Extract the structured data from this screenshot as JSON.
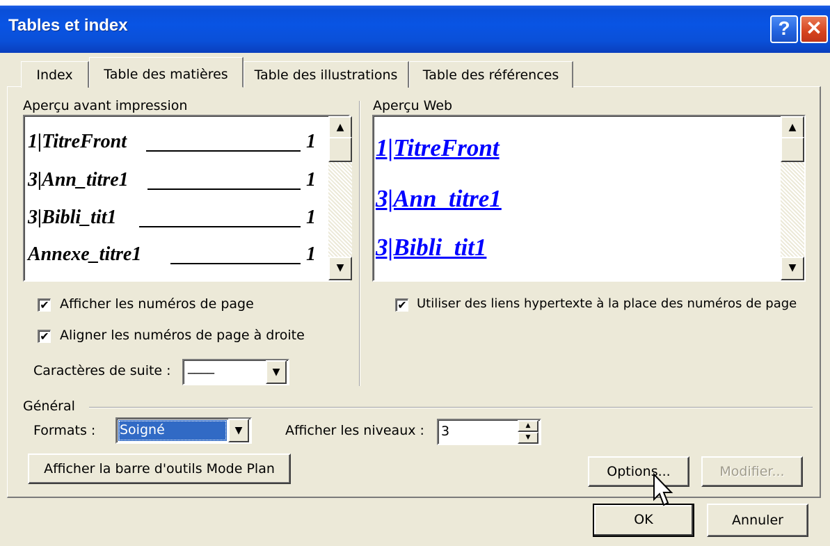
{
  "window": {
    "title": "Tables et index"
  },
  "title_buttons": {
    "help": "?",
    "close": "✕"
  },
  "tabs": [
    {
      "label": "Index"
    },
    {
      "label": "Table des matières"
    },
    {
      "label": "Table des illustrations"
    },
    {
      "label": "Table des références"
    }
  ],
  "print_preview": {
    "label": "Aperçu avant impression",
    "entries": [
      {
        "text": "1|TitreFront",
        "page": "1"
      },
      {
        "text": "3|Ann_titre1",
        "page": "1"
      },
      {
        "text": "3|Bibli_tit1",
        "page": "1"
      },
      {
        "text": "Annexe_titre1",
        "page": "1"
      }
    ]
  },
  "web_preview": {
    "label": "Aperçu Web",
    "links": [
      "1|TitreFront",
      "3|Ann_titre1",
      "3|Bibli_tit1"
    ]
  },
  "options": {
    "show_page_numbers": {
      "label": "Afficher les numéros de page",
      "checked": true
    },
    "right_align": {
      "label": "Aligner les numéros de page à droite",
      "checked": true
    },
    "tab_leader": {
      "label": "Caractères de suite :",
      "value": "____"
    },
    "use_hyperlinks": {
      "label": "Utiliser des liens hypertexte à la place des numéros de page",
      "checked": true
    }
  },
  "general": {
    "label": "Général",
    "formats": {
      "label": "Formats :",
      "value": "Soigné"
    },
    "levels": {
      "label": "Afficher les niveaux :",
      "value": "3"
    }
  },
  "buttons": {
    "outline_toolbar": "Afficher la barre d'outils Mode Plan",
    "options": "Options...",
    "modify": "Modifier...",
    "ok": "OK",
    "cancel": "Annuler"
  },
  "scroll_glyphs": {
    "up": "▲",
    "down": "▼"
  },
  "check_glyph": "✔",
  "colors": {
    "titlebar": "#0a50d8",
    "hyperlink": "#0000ff",
    "selection": "#316ac5"
  }
}
